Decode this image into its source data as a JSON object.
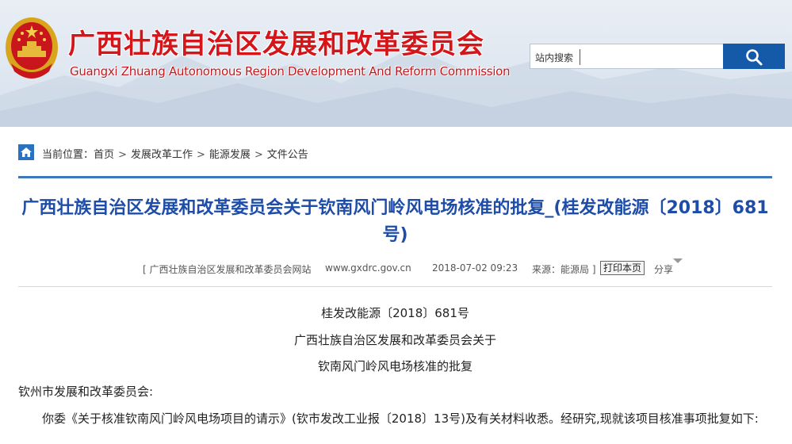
{
  "header": {
    "title_cn": "广西壮族自治区发展和改革委员会",
    "title_en": "Guangxi Zhuang Autonomous Region Development And Reform Commission",
    "emblem_icon": "national-emblem-icon",
    "colors": {
      "title": "#d4161a",
      "search_button": "#155aa8",
      "accent": "#3d78bd",
      "headline": "#1d4da8"
    }
  },
  "search": {
    "label": "站内搜索",
    "value": "",
    "button_icon": "search-icon"
  },
  "breadcrumb": {
    "icon": "home-icon",
    "prefix": "当前位置：",
    "items": [
      "首页",
      "发展改革工作",
      "能源发展",
      "文件公告"
    ],
    "separator": ">"
  },
  "article": {
    "title": "广西壮族自治区发展和改革委员会关于钦南风门岭风电场核准的批复_(桂发改能源〔2018〕681号)",
    "meta": {
      "source_site": "[ 广西壮族自治区发展和改革委员会网站",
      "url": "www.gxdrc.gov.cn",
      "datetime": "2018-07-02 09:23",
      "source": "来源：能源局 ]",
      "print_label": "打印本页",
      "share_label": "分享"
    },
    "doc_number": "桂发改能源〔2018〕681号",
    "heading_line1": "广西壮族自治区发展和改革委员会关于",
    "heading_line2": "钦南风门岭风电场核准的批复",
    "addressee": "钦州市发展和改革委员会:",
    "paragraph1": "你委《关于核准钦南风门岭风电场项目的请示》(钦市发改工业报〔2018〕13号)及有关材料收悉。经研究,现就该项目核准事项批复如下:"
  }
}
